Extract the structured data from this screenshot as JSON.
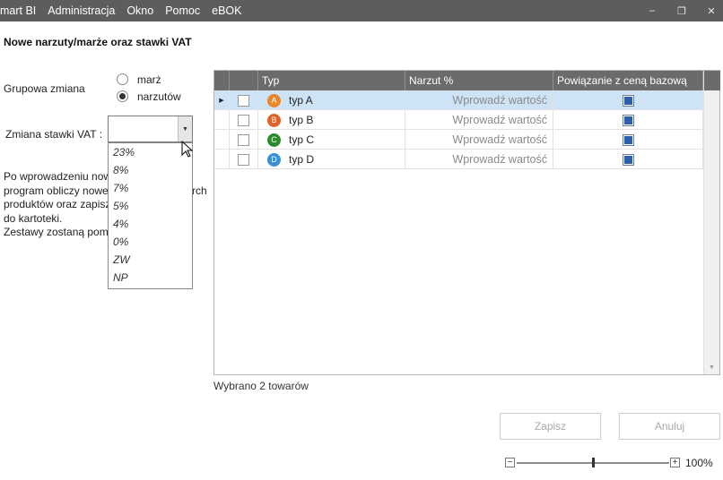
{
  "menu": [
    "mart BI",
    "Administracja",
    "Okno",
    "Pomoc",
    "eBOK"
  ],
  "window_controls": {
    "minimize": "–",
    "restore": "❐",
    "close": "✕"
  },
  "page_title": "Nowe narzuty/marże oraz stawki VAT",
  "group_change": {
    "label": "Grupowa zmiana",
    "options": [
      {
        "label": "marż",
        "checked": false
      },
      {
        "label": "narzutów",
        "checked": true
      }
    ]
  },
  "vat": {
    "label": "Zmiana stawki VAT :",
    "value": "",
    "options": [
      "23%",
      "8%",
      "7%",
      "5%",
      "4%",
      "0%",
      "ZW",
      "NP"
    ]
  },
  "description": [
    "Po wprowadzeniu now",
    "program obliczy nowe",
    "produktów oraz zapisz",
    "do kartoteki.",
    "Zestawy zostaną pomi"
  ],
  "description_overflow": "rch",
  "grid": {
    "columns": {
      "type": "Typ",
      "markup": "Narzut %",
      "link": "Powiązanie z ceną bazową"
    },
    "rows": [
      {
        "badge": "A",
        "badge_color": "#e8862a",
        "type": "typ A",
        "markup_placeholder": "Wprowadź wartość",
        "linked": true,
        "selected": true
      },
      {
        "badge": "B",
        "badge_color": "#e0622a",
        "type": "typ B",
        "markup_placeholder": "Wprowadź wartość",
        "linked": true,
        "selected": false
      },
      {
        "badge": "C",
        "badge_color": "#2e8a2e",
        "type": "typ C",
        "markup_placeholder": "Wprowadź wartość",
        "linked": true,
        "selected": false
      },
      {
        "badge": "D",
        "badge_color": "#3b8fd6",
        "type": "typ D",
        "markup_placeholder": "Wprowadź wartość",
        "linked": true,
        "selected": false
      }
    ]
  },
  "selection_info": "Wybrano 2 towarów",
  "buttons": {
    "save": "Zapisz",
    "cancel": "Anuluj"
  },
  "zoom": {
    "minus": "−",
    "plus": "+",
    "value": "100%",
    "level": 0.5
  }
}
